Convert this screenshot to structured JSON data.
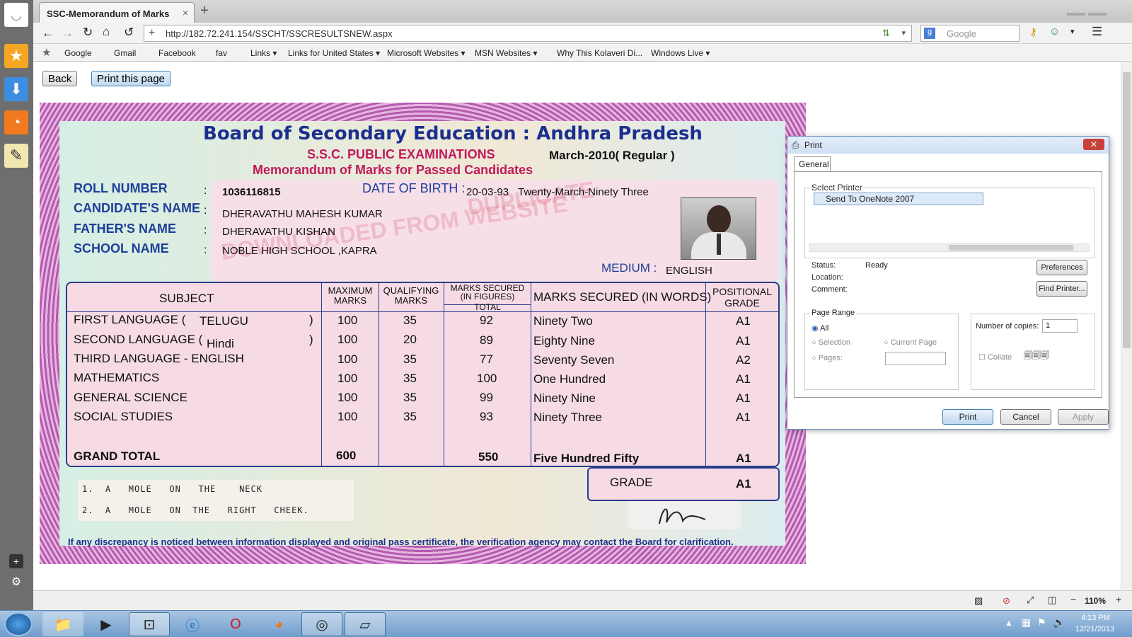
{
  "browser": {
    "tab_title": "SSC-Memorandum of Marks",
    "url": "http://182.72.241.154/SSCHT/SSCRESULTSNEW.aspx",
    "search_placeholder": "Google",
    "bookmarks": [
      "Google",
      "Gmail",
      "Facebook",
      "fav",
      "Links ▾",
      "Links for United States ▾",
      "Microsoft Websites ▾",
      "MSN Websites ▾",
      "Why This Kolaveri Di...",
      "Windows Live ▾"
    ],
    "zoom": "110%"
  },
  "page": {
    "back_label": "Back",
    "print_label": "Print this page"
  },
  "certificate": {
    "title": "Board of Secondary Education : Andhra Pradesh",
    "exam": "S.S.C. PUBLIC EXAMINATIONS",
    "session": "March-2010( Regular )",
    "subtitle": "Memorandum of Marks for Passed Candidates",
    "labels": {
      "roll": "ROLL NUMBER",
      "name": "CANDIDATE'S NAME",
      "father": "FATHER'S NAME",
      "school": "SCHOOL NAME",
      "dob": "DATE OF BIRTH :",
      "medium": "MEDIUM :"
    },
    "roll_number": "1036116815",
    "dob": "20-03-93",
    "dob_words": "Twenty-March-Ninety Three",
    "candidate_name": "DHERAVATHU MAHESH KUMAR",
    "father_name": "DHERAVATHU KISHAN",
    "school_name": "NOBLE HIGH SCHOOL ,KAPRA",
    "medium": "ENGLISH",
    "watermark_1": "DUPLICATE",
    "watermark_2": "DOWNLOADED FROM WEBSITE",
    "headers": {
      "subject": "SUBJECT",
      "max": "MAXIMUM MARKS",
      "qual": "QUALIFYING MARKS",
      "secured_fig": "MARKS SECURED (IN FIGURES)",
      "total": "TOTAL",
      "words": "MARKS SECURED (IN WORDS)",
      "grade": "POSITIONAL GRADE"
    },
    "rows": [
      {
        "subject": "FIRST LANGUAGE  (",
        "lang": "TELUGU",
        "close": ")",
        "max": "100",
        "qual": "35",
        "marks": "92",
        "words": "Ninety Two",
        "grade": "A1"
      },
      {
        "subject": "SECOND LANGUAGE (",
        "lang": "Hindi",
        "close": ")",
        "max": "100",
        "qual": "20",
        "marks": "89",
        "words": "Eighty Nine",
        "grade": "A1"
      },
      {
        "subject": "THIRD LANGUAGE - ENGLISH",
        "lang": "",
        "close": "",
        "max": "100",
        "qual": "35",
        "marks": "77",
        "words": "Seventy Seven",
        "grade": "A2"
      },
      {
        "subject": "MATHEMATICS",
        "lang": "",
        "close": "",
        "max": "100",
        "qual": "35",
        "marks": "100",
        "words": "One Hundred",
        "grade": "A1"
      },
      {
        "subject": "GENERAL SCIENCE",
        "lang": "",
        "close": "",
        "max": "100",
        "qual": "35",
        "marks": "99",
        "words": "Ninety Nine",
        "grade": "A1"
      },
      {
        "subject": "SOCIAL STUDIES",
        "lang": "",
        "close": "",
        "max": "100",
        "qual": "35",
        "marks": "93",
        "words": "Ninety Three",
        "grade": "A1"
      }
    ],
    "grand_total_label": "GRAND TOTAL",
    "grand_total_max": "600",
    "grand_total_marks": "550",
    "grand_total_words": "Five Hundred Fifty",
    "grand_total_grade": "A1",
    "grade_label": "GRADE",
    "grade_value": "A1",
    "id_marks": [
      "1.  A   MOLE   ON   THE    NECK",
      "2.  A   MOLE   ON  THE   RIGHT   CHEEK."
    ],
    "footer": "If any discrepancy is noticed between information displayed and original pass certificate, the verification agency may contact the Board for clarification."
  },
  "print_dialog": {
    "title": "Print",
    "tab": "General",
    "select_printer": "Select Printer",
    "printer": "Send To OneNote 2007",
    "status_label": "Status:",
    "status_value": "Ready",
    "location_label": "Location:",
    "comment_label": "Comment:",
    "preferences": "Preferences",
    "find_printer": "Find Printer...",
    "page_range": "Page Range",
    "all": "All",
    "selection": "Selection",
    "current_page": "Current Page",
    "pages": "Pages:",
    "copies_label": "Number of copies:",
    "copies_value": "1",
    "collate": "Collate",
    "print_btn": "Print",
    "cancel_btn": "Cancel",
    "apply_btn": "Apply"
  },
  "taskbar": {
    "time": "4:13 PM",
    "date": "12/21/2013"
  }
}
